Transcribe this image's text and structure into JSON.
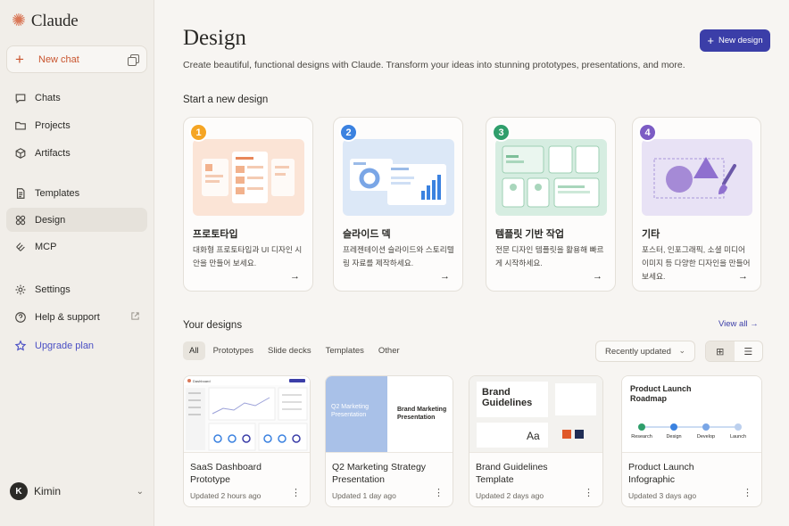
{
  "app": {
    "name": "Claude"
  },
  "sidebar": {
    "new_chat": "New chat",
    "items": [
      {
        "label": "Chats",
        "icon": "chat-bubble-icon"
      },
      {
        "label": "Projects",
        "icon": "folder-icon"
      },
      {
        "label": "Artifacts",
        "icon": "cube-icon"
      },
      {
        "label": "Templates",
        "icon": "document-icon"
      },
      {
        "label": "Design",
        "icon": "grid-icon",
        "active": true
      },
      {
        "label": "MCP",
        "icon": "plug-icon"
      },
      {
        "label": "Settings",
        "icon": "gear-icon"
      },
      {
        "label": "Help & support",
        "icon": "help-icon"
      },
      {
        "label": "Upgrade plan",
        "icon": "star-icon"
      }
    ],
    "user": {
      "initial": "K",
      "name": "Kimin"
    }
  },
  "header": {
    "title": "Design",
    "subtitle": "Create beautiful, functional designs with Claude. Transform your ideas into stunning prototypes, presentations, and more.",
    "new_design_label": "New design"
  },
  "start": {
    "title": "Start a new design",
    "cards": [
      {
        "num": "1",
        "title": "프로토타입",
        "desc": "대화형 프로토타입과 UI 디자인 시안을 만들어 보세요.",
        "color": "#f5a524",
        "bg": "#fbe4d6"
      },
      {
        "num": "2",
        "title": "슬라이드 덱",
        "desc": "프레젠테이션 슬라이드와 스토리텔링 자료를 제작하세요.",
        "color": "#3b82e0",
        "bg": "#dce8f7"
      },
      {
        "num": "3",
        "title": "템플릿 기반 작업",
        "desc": "전문 디자인 템플릿을 활용해 빠르게 시작하세요.",
        "color": "#2f9e6b",
        "bg": "#d6ede1"
      },
      {
        "num": "4",
        "title": "기타",
        "desc": "포스터, 인포그래픽, 소셜 미디어 이미지 등 다양한 디자인을 만들어 보세요.",
        "color": "#7c5cc4",
        "bg": "#e8e2f5"
      }
    ]
  },
  "your_designs": {
    "title": "Your designs",
    "view_all": "View all",
    "filters": [
      "All",
      "Prototypes",
      "Slide decks",
      "Templates",
      "Other"
    ],
    "sort_label": "Recently updated",
    "items": [
      {
        "title": "SaaS Dashboard Prototype",
        "meta": "Updated 2 hours ago",
        "thumb": {
          "brand": "Dashboard"
        }
      },
      {
        "title": "Q2 Marketing Strategy Presentation",
        "meta": "Updated 1 day ago",
        "thumb": {
          "left": "Q2 Marketing Presentation",
          "right": "Brand Marketing Presentation"
        }
      },
      {
        "title": "Brand Guidelines Template",
        "meta": "Updated 2 days ago",
        "thumb": {
          "heading": "Brand Guidelines",
          "aa": "Aa"
        }
      },
      {
        "title": "Product Launch Infographic",
        "meta": "Updated 3 days ago",
        "thumb": {
          "heading": "Product Launch Roadmap",
          "steps": [
            "Research",
            "Design",
            "Develop",
            "Launch"
          ]
        }
      }
    ]
  },
  "colors": {
    "accent": "#3b3ea8",
    "brand": "#d97757",
    "new_chat": "#c9552f"
  }
}
